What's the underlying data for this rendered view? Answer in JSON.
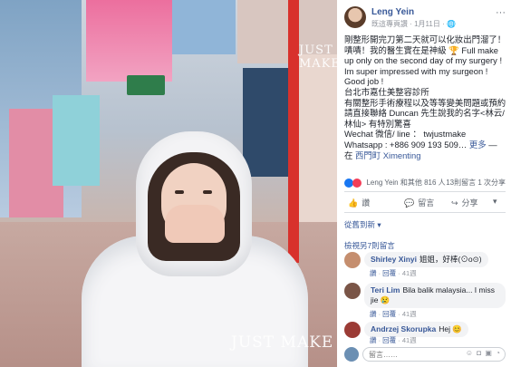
{
  "post": {
    "author": "Leng Yein",
    "page": "既這專頁讚",
    "date": "1月11日",
    "caption_lines": [
      "剛整形開完刀第二天就可以化妝出門溜了！嘖嘖！我的醫生實在是神級 🏆 Full make up only on the second day of my surgery ! Im super impressed with my surgeon ! Good job !",
      "台北市嘉仕美整容診所",
      "有關整形手術療程以及等等變美問題或預約請直接聯絡 Duncan 先生說我的名字<林云/林仙> 有特別驚喜",
      "Wechat 微信/ line ： twjustmake",
      "Whatsapp : +886 909 193 509"
    ],
    "see_more": "更多",
    "location_prefix": "— 在",
    "location": "西門町 Ximenting",
    "reactions_text": "Leng Yein 和其他 816 人",
    "comments_count": "13則留言",
    "share_count": "1 次分享"
  },
  "actions": {
    "like": "讚",
    "comment": "留言",
    "share": "分享"
  },
  "filter_label": "從舊到新 ▾",
  "prev_comments": "檢視另7則留言",
  "comments": [
    {
      "name": "Shirley Xinyi",
      "text": "姐姐，好棒(⊙o⊙)",
      "like": "讚",
      "reply": "回覆",
      "time": "41週"
    },
    {
      "name": "Teri Lim",
      "text": "Bila balik malaysia... I miss jie 😢",
      "like": "讚",
      "reply": "回覆",
      "time": "41週"
    },
    {
      "name": "Andrzej Skorupka",
      "text": "Hej 😊",
      "like": "讚",
      "reply": "回覆",
      "time": "41週"
    }
  ],
  "compose_placeholder": "留言……",
  "watermarks": [
    "JUST MAKE",
    "JUST MAKE"
  ],
  "colors": {
    "link": "#385898",
    "like": "#1877f2",
    "love": "#f33e58",
    "pole": "#d8312c"
  },
  "icons": {
    "globe": "globe-icon",
    "more": "more-options-icon",
    "like": "thumbs-up-icon",
    "comment": "comment-bubble-icon",
    "share": "share-arrow-icon"
  }
}
